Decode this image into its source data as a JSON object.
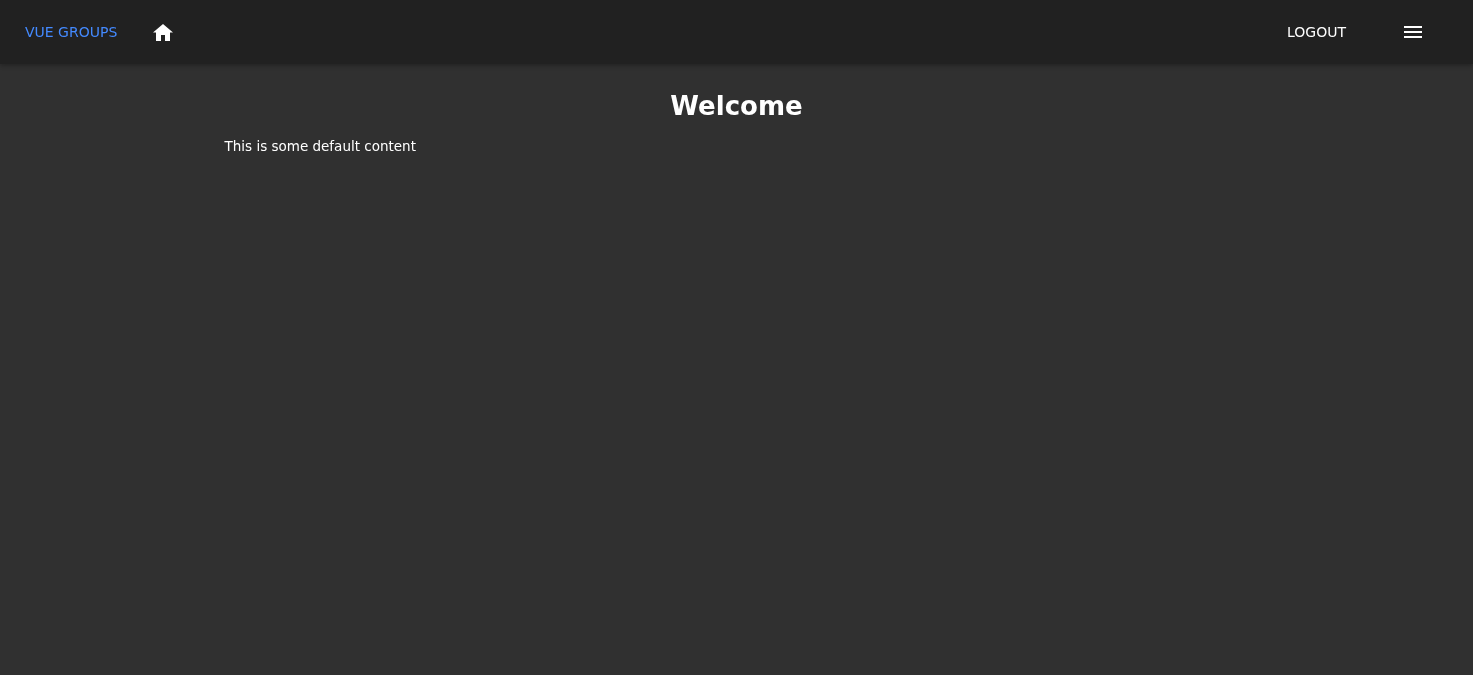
{
  "navbar": {
    "brand": "VUE GROUPS",
    "actions": [
      {
        "label": "LOGOUT"
      }
    ]
  },
  "main": {
    "heading": "Welcome",
    "paragraph": "This is some default content"
  }
}
